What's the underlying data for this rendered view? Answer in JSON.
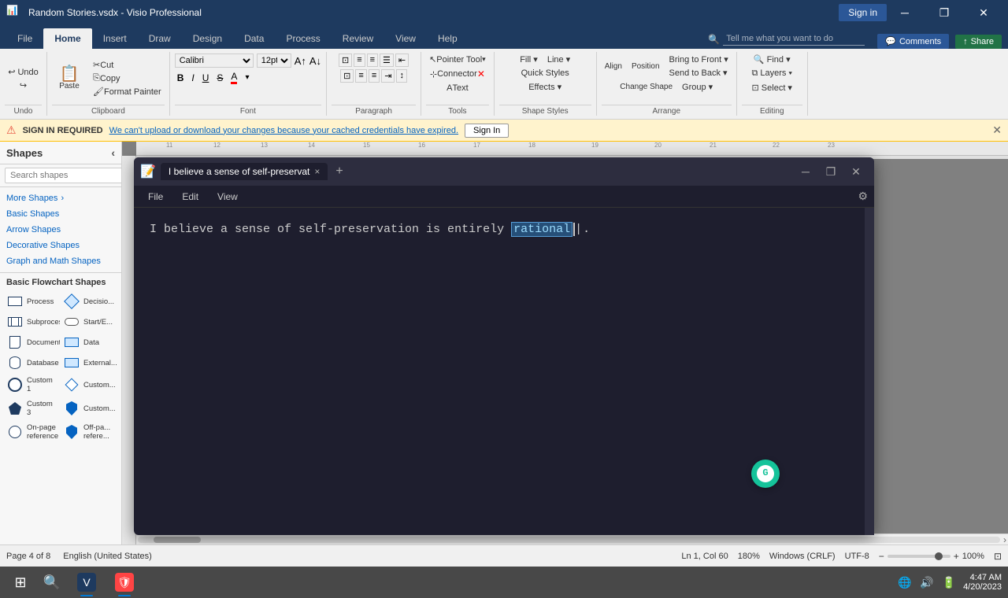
{
  "title_bar": {
    "logo": "📊",
    "title": "Random Stories.vsdx - Visio Professional",
    "sign_in": "Sign in",
    "minimize": "─",
    "maximize": "❐",
    "close": "✕"
  },
  "ribbon_tabs": {
    "items": [
      "File",
      "Home",
      "Insert",
      "Draw",
      "Design",
      "Data",
      "Process",
      "Review",
      "View",
      "Help"
    ],
    "active": "Home"
  },
  "ribbon_search": {
    "placeholder": "Tell me what you want to do"
  },
  "ribbon_actions": {
    "comments": "Comments",
    "share": "Share"
  },
  "ribbon": {
    "undo_label": "Undo",
    "clipboard_label": "Clipboard",
    "font_label": "Font",
    "paragraph_label": "Paragraph",
    "tools_label": "Tools",
    "shape_styles_label": "Shape Styles",
    "arrange_label": "Arrange",
    "editing_label": "Editing",
    "paste": "Paste",
    "cut": "Cut",
    "copy": "Copy",
    "format_painter": "Format Painter",
    "font_name": "Calibri",
    "font_size": "12pt",
    "pointer_tool": "Pointer Tool",
    "connector": "Connector",
    "text": "Text",
    "fill": "Fill",
    "line": "Line",
    "quick_styles": "Quick Styles",
    "effects": "Effects",
    "align": "Align",
    "position": "Position",
    "bring_to_front": "Bring to Front",
    "send_to_back": "Send to Back",
    "group": "Group",
    "change_shape": "Change Shape",
    "find": "Find",
    "layers": "Layers",
    "select": "Select"
  },
  "notification": {
    "warn_text": "SIGN IN REQUIRED",
    "message": "We can't upload or download your changes because your cached credentials have expired.",
    "sign_in": "Sign In"
  },
  "shapes_panel": {
    "title": "Shapes",
    "search_placeholder": "Search shapes",
    "nav_items": [
      "More Shapes",
      "Basic Shapes",
      "Arrow Shapes",
      "Decorative Shapes",
      "Graph and Math Shapes",
      "Basic Flowchart Shapes"
    ],
    "section_title": "Basic Flowchart Shapes",
    "shapes": [
      {
        "label": "Process",
        "type": "rect"
      },
      {
        "label": "Decision",
        "type": "diamond"
      },
      {
        "label": "Subprocess",
        "type": "rect"
      },
      {
        "label": "Start/E...",
        "type": "pill"
      },
      {
        "label": "Document",
        "type": "doc"
      },
      {
        "label": "Data",
        "type": "rect-blue"
      },
      {
        "label": "Database",
        "type": "cylinder"
      },
      {
        "label": "External...",
        "type": "rect-blue"
      },
      {
        "label": "Custom 1",
        "type": "custom-circle"
      },
      {
        "label": "Custom...",
        "type": "custom-diamond"
      },
      {
        "label": "Custom 3",
        "type": "pentagon"
      },
      {
        "label": "Custom...",
        "type": "shield"
      },
      {
        "label": "On-page reference",
        "type": "ref-circle"
      },
      {
        "label": "Off-page refere...",
        "type": "shield-blue"
      }
    ]
  },
  "notepad": {
    "title": "I believe a sense of self-preservat",
    "menu": [
      "File",
      "Edit",
      "View"
    ],
    "content_before": "I believe a sense of self-preservation is entirely ",
    "content_highlight": "rational",
    "content_after": ".",
    "cursor_visible": true
  },
  "status_bar": {
    "page_info": "Page 4 of 8",
    "language": "English (United States)",
    "ln_col": "Ln 1, Col 60",
    "zoom": "180%",
    "line_ending": "Windows (CRLF)",
    "encoding": "UTF-8",
    "zoom_percent": "100%"
  },
  "taskbar": {
    "time": "4:47 AM",
    "date": "4/20/2023",
    "apps": [
      "⊞",
      "🔍",
      "🛡️"
    ]
  }
}
